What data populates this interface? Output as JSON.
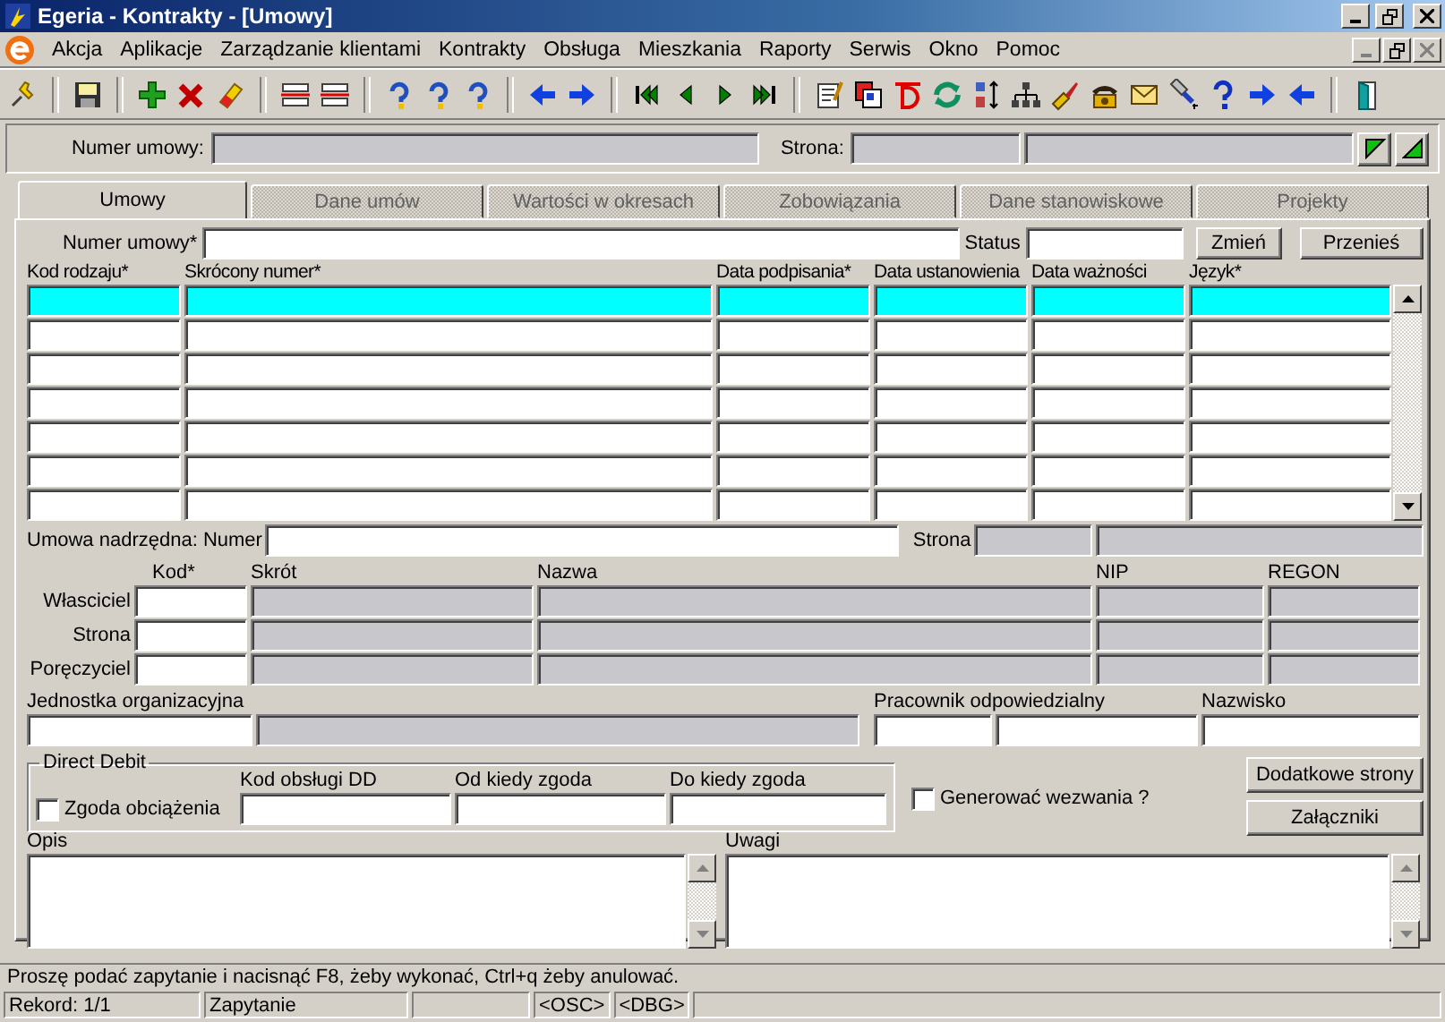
{
  "window": {
    "title": "Egeria - Kontrakty - [Umowy]"
  },
  "menu": [
    "Akcja",
    "Aplikacje",
    "Zarządzanie klientami",
    "Kontrakty",
    "Obsługa",
    "Mieszkania",
    "Raporty",
    "Serwis",
    "Okno",
    "Pomoc"
  ],
  "header": {
    "numer_label": "Numer umowy:",
    "strona_label": "Strona:"
  },
  "tabs": [
    {
      "label": "Umowy",
      "selected": true
    },
    {
      "label": "Dane umów",
      "selected": false
    },
    {
      "label": "Wartości  w okresach",
      "selected": false
    },
    {
      "label": "Zobowiązania",
      "selected": false
    },
    {
      "label": "Dane stanowiskowe",
      "selected": false
    },
    {
      "label": "Projekty",
      "selected": false
    }
  ],
  "form": {
    "numer_label": "Numer umowy*",
    "status_label": "Status",
    "buttons": [
      "Zmień",
      "Przenieś"
    ]
  },
  "grid": {
    "columns": [
      "Kod rodzaju*",
      "Skrócony numer*",
      "Data podpisania*",
      "Data ustanowienia",
      "Data ważności",
      "Język*"
    ],
    "rows": [
      {
        "selected": true
      },
      {
        "selected": false
      },
      {
        "selected": false
      },
      {
        "selected": false
      },
      {
        "selected": false
      },
      {
        "selected": false
      },
      {
        "selected": false
      }
    ]
  },
  "parent": {
    "label": "Umowa nadrzędna: Numer",
    "strona_label": "Strona"
  },
  "parties": {
    "columns": [
      "Kod*",
      "Skrót",
      "Nazwa",
      "NIP",
      "REGON"
    ],
    "rows": [
      "Własciciel",
      "Strona",
      "Poręczyciel"
    ]
  },
  "unit": {
    "label": "Jednostka organizacyjna",
    "pracownik_label": "Pracownik odpowiedzialny",
    "nazwisko_label": "Nazwisko"
  },
  "direct_debit": {
    "title": "Direct Debit",
    "consent": {
      "label": "Zgoda obciążenia",
      "checked": false
    },
    "columns": [
      "Kod obsługi DD",
      "Od kiedy zgoda",
      "Do kiedy zgoda"
    ]
  },
  "generate": {
    "label": "Generować wezwania ?",
    "checked": false
  },
  "side_buttons": [
    "Dodatkowe strony",
    "Załączniki"
  ],
  "notes": [
    "Opis",
    "Uwagi"
  ],
  "message": "Proszę podać zapytanie i nacisnąć F8, żeby wykonać, Ctrl+q  żeby anulować.",
  "status_bar": [
    "Rekord: 1/1",
    "Zapytanie",
    "<OSC>",
    "<DBG>"
  ]
}
